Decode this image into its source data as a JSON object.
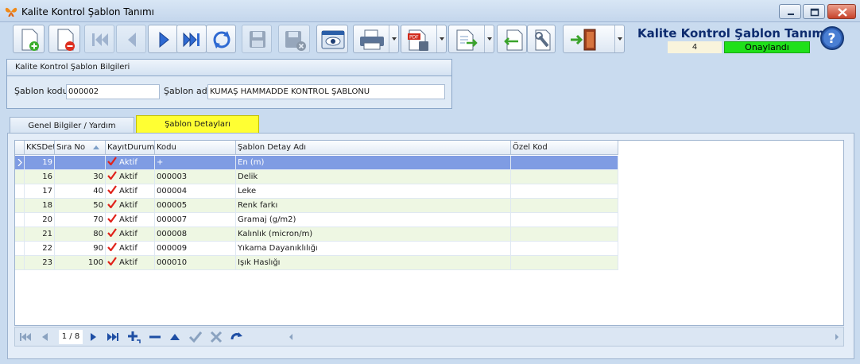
{
  "window": {
    "title": "Kalite Kontrol Şablon Tanımı"
  },
  "header": {
    "doc_title": "Kalite Kontrol Şablon Tanımı",
    "record_no": "4",
    "status": "Onaylandı"
  },
  "colors": {
    "status": "#1fe01a",
    "active_tab": "#ffff33",
    "selected_row": "#7f9ce3"
  },
  "group": {
    "title": "Kalite Kontrol Şablon Bilgileri",
    "code_label": "Şablon kodu",
    "code_value": "000002",
    "name_label": "Şablon adı",
    "name_value": "KUMAŞ HAMMADDE KONTROL ŞABLONU"
  },
  "tabs": [
    {
      "label": "Genel Bilgiler / Yardım"
    },
    {
      "label": "Şablon Detayları"
    }
  ],
  "grid": {
    "columns": [
      "KKSDetId",
      "Sıra No",
      "KayıtDurumu",
      "Kodu",
      "Şablon Detay Adı",
      "Özel Kod"
    ],
    "rows": [
      {
        "id": "19",
        "sira": "",
        "durum": "Aktif",
        "kod": "+",
        "ad": "En (m)",
        "ozel": ""
      },
      {
        "id": "16",
        "sira": "30",
        "durum": "Aktif",
        "kod": "000003",
        "ad": "Delik",
        "ozel": ""
      },
      {
        "id": "17",
        "sira": "40",
        "durum": "Aktif",
        "kod": "000004",
        "ad": "Leke",
        "ozel": ""
      },
      {
        "id": "18",
        "sira": "50",
        "durum": "Aktif",
        "kod": "000005",
        "ad": "Renk farkı",
        "ozel": ""
      },
      {
        "id": "20",
        "sira": "70",
        "durum": "Aktif",
        "kod": "000007",
        "ad": "Gramaj (g/m2)",
        "ozel": ""
      },
      {
        "id": "21",
        "sira": "80",
        "durum": "Aktif",
        "kod": "000008",
        "ad": "Kalınlık (micron/m)",
        "ozel": ""
      },
      {
        "id": "22",
        "sira": "90",
        "durum": "Aktif",
        "kod": "000009",
        "ad": "Yıkama Dayanıklılığı",
        "ozel": ""
      },
      {
        "id": "23",
        "sira": "100",
        "durum": "Aktif",
        "kod": "000010",
        "ad": "Işık Haslığı",
        "ozel": ""
      }
    ]
  },
  "navigator": {
    "pager": "1 / 8"
  },
  "icons": {
    "app": "butterfly-icon",
    "new": "new-document-icon",
    "delete": "delete-document-icon",
    "first": "first-icon",
    "prev": "prev-icon",
    "next": "next-icon",
    "last": "last-icon",
    "refresh": "refresh-icon",
    "save": "save-icon",
    "save_close": "save-close-icon",
    "preview": "preview-icon",
    "print": "printer-icon",
    "pdf": "pdf-icon",
    "export": "export-icon",
    "import": "import-icon",
    "settings": "settings-icon",
    "exit": "exit-door-icon",
    "help": "help-icon"
  }
}
